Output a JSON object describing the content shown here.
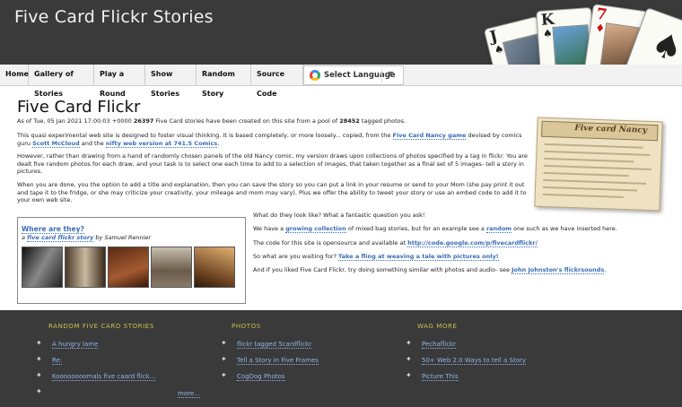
{
  "header": {
    "title": "Five Card Flickr Stories",
    "cards": [
      {
        "rank": "J",
        "suit": "♠",
        "color": "#111111"
      },
      {
        "rank": "K",
        "suit": "♠",
        "color": "#111111"
      },
      {
        "rank": "7",
        "suit": "♦",
        "color": "#cc1111"
      },
      {
        "rank": "",
        "suit": "♠",
        "color": "#111111"
      }
    ]
  },
  "nav": {
    "items": [
      "Home",
      "Gallery of Stories",
      "Play a Round",
      "Show Stories",
      "Random Story",
      "Source Code"
    ],
    "language_label": "Select Language"
  },
  "main": {
    "title": "Five Card Flickr",
    "stats": {
      "prefix": "As of Tue, 05 Jan 2021 17:00:03 +0000",
      "stories_count": "26397",
      "middle": "Five Card stories have been created on this site from a pool of",
      "photos_count": "28452",
      "suffix": "tagged photos."
    },
    "para1": {
      "a": "This quasi experimental web site is designed to foster visual thinking. It is based completely, or more loosely... copied, from the",
      "link1": "Five Card Nancy game",
      "b": "devised by comics guru",
      "link2": "Scott McCloud",
      "c": "and the",
      "link3": "nifty web version at 741.5 Comics",
      "d": "."
    },
    "para2": "However, rather than drawing from a hand of randomly chosen panels of the old Nancy comic, my version draws upon collections of photos specified by a tag in flickr. You are dealt five random photos for each draw, and your task is to select one each time to add to a selection of images, that taken together as a final set of 5 images- tell a story in pictures.",
    "para3": "When you are done, you the option to add a title and explanation, then you can save the story so you can put a link in your resume or send to your Mom (she pay print it out and tape it to the fridge, or she may criticize your creativity, your mileage and mom may vary). Plus we offer the ability to tweet your story or use an embed code to add it to your own web site.",
    "comic_title": "Five card Nancy",
    "story_box": {
      "title": "Where are they?",
      "sub_prefix": "a",
      "sub_link": "five card flickr story",
      "sub_suffix": "by Samuel Rennier",
      "thumb_colors": [
        "#2c2c2c",
        "#6b5a4a",
        "#8a4a2a",
        "#9a8a7a",
        "#b07848"
      ]
    },
    "right": {
      "q": "What do they look like? What a fantastic question you ask!",
      "p1_a": "We have a",
      "p1_link1": "growing collection",
      "p1_b": "of mixed bag stories, but for an example see a",
      "p1_link2": "random",
      "p1_c": "one such as we have inserted here.",
      "p2_a": "The code for this site is opensource and available at",
      "p2_link": "http://code.google.com/p/fivecardflickr/",
      "p3_a": "So what are you waiting for?",
      "p3_link": "Take a fling at weaving a tale with pictures only!",
      "p4_a": "And if you liked Five Card Flickr, try doing something similar with photos and audio- see",
      "p4_link": "John Johnston's flickrsounds",
      "p4_b": "."
    }
  },
  "footer": {
    "col1": {
      "heading": "RANDOM FIVE CARD STORIES",
      "links": [
        "A hungry lame",
        "Re:",
        "Koooooooomals five caard flick..."
      ],
      "more": "more..."
    },
    "col2": {
      "heading": "PHOTOS",
      "links": [
        "flickr tagged 5cardflickr",
        "Tell a Story in Five Frames",
        "CogDog Photos"
      ]
    },
    "col3": {
      "heading": "WAG MORE",
      "links": [
        "Pechaflickr",
        "50+ Web 2.0 Ways to tell a Story",
        "Picture This"
      ]
    }
  },
  "colors": {
    "header_bg": "#3a3a3a",
    "link": "#3a6db5",
    "footer_heading": "#c9c04c",
    "footer_link": "#8fb4e8"
  }
}
